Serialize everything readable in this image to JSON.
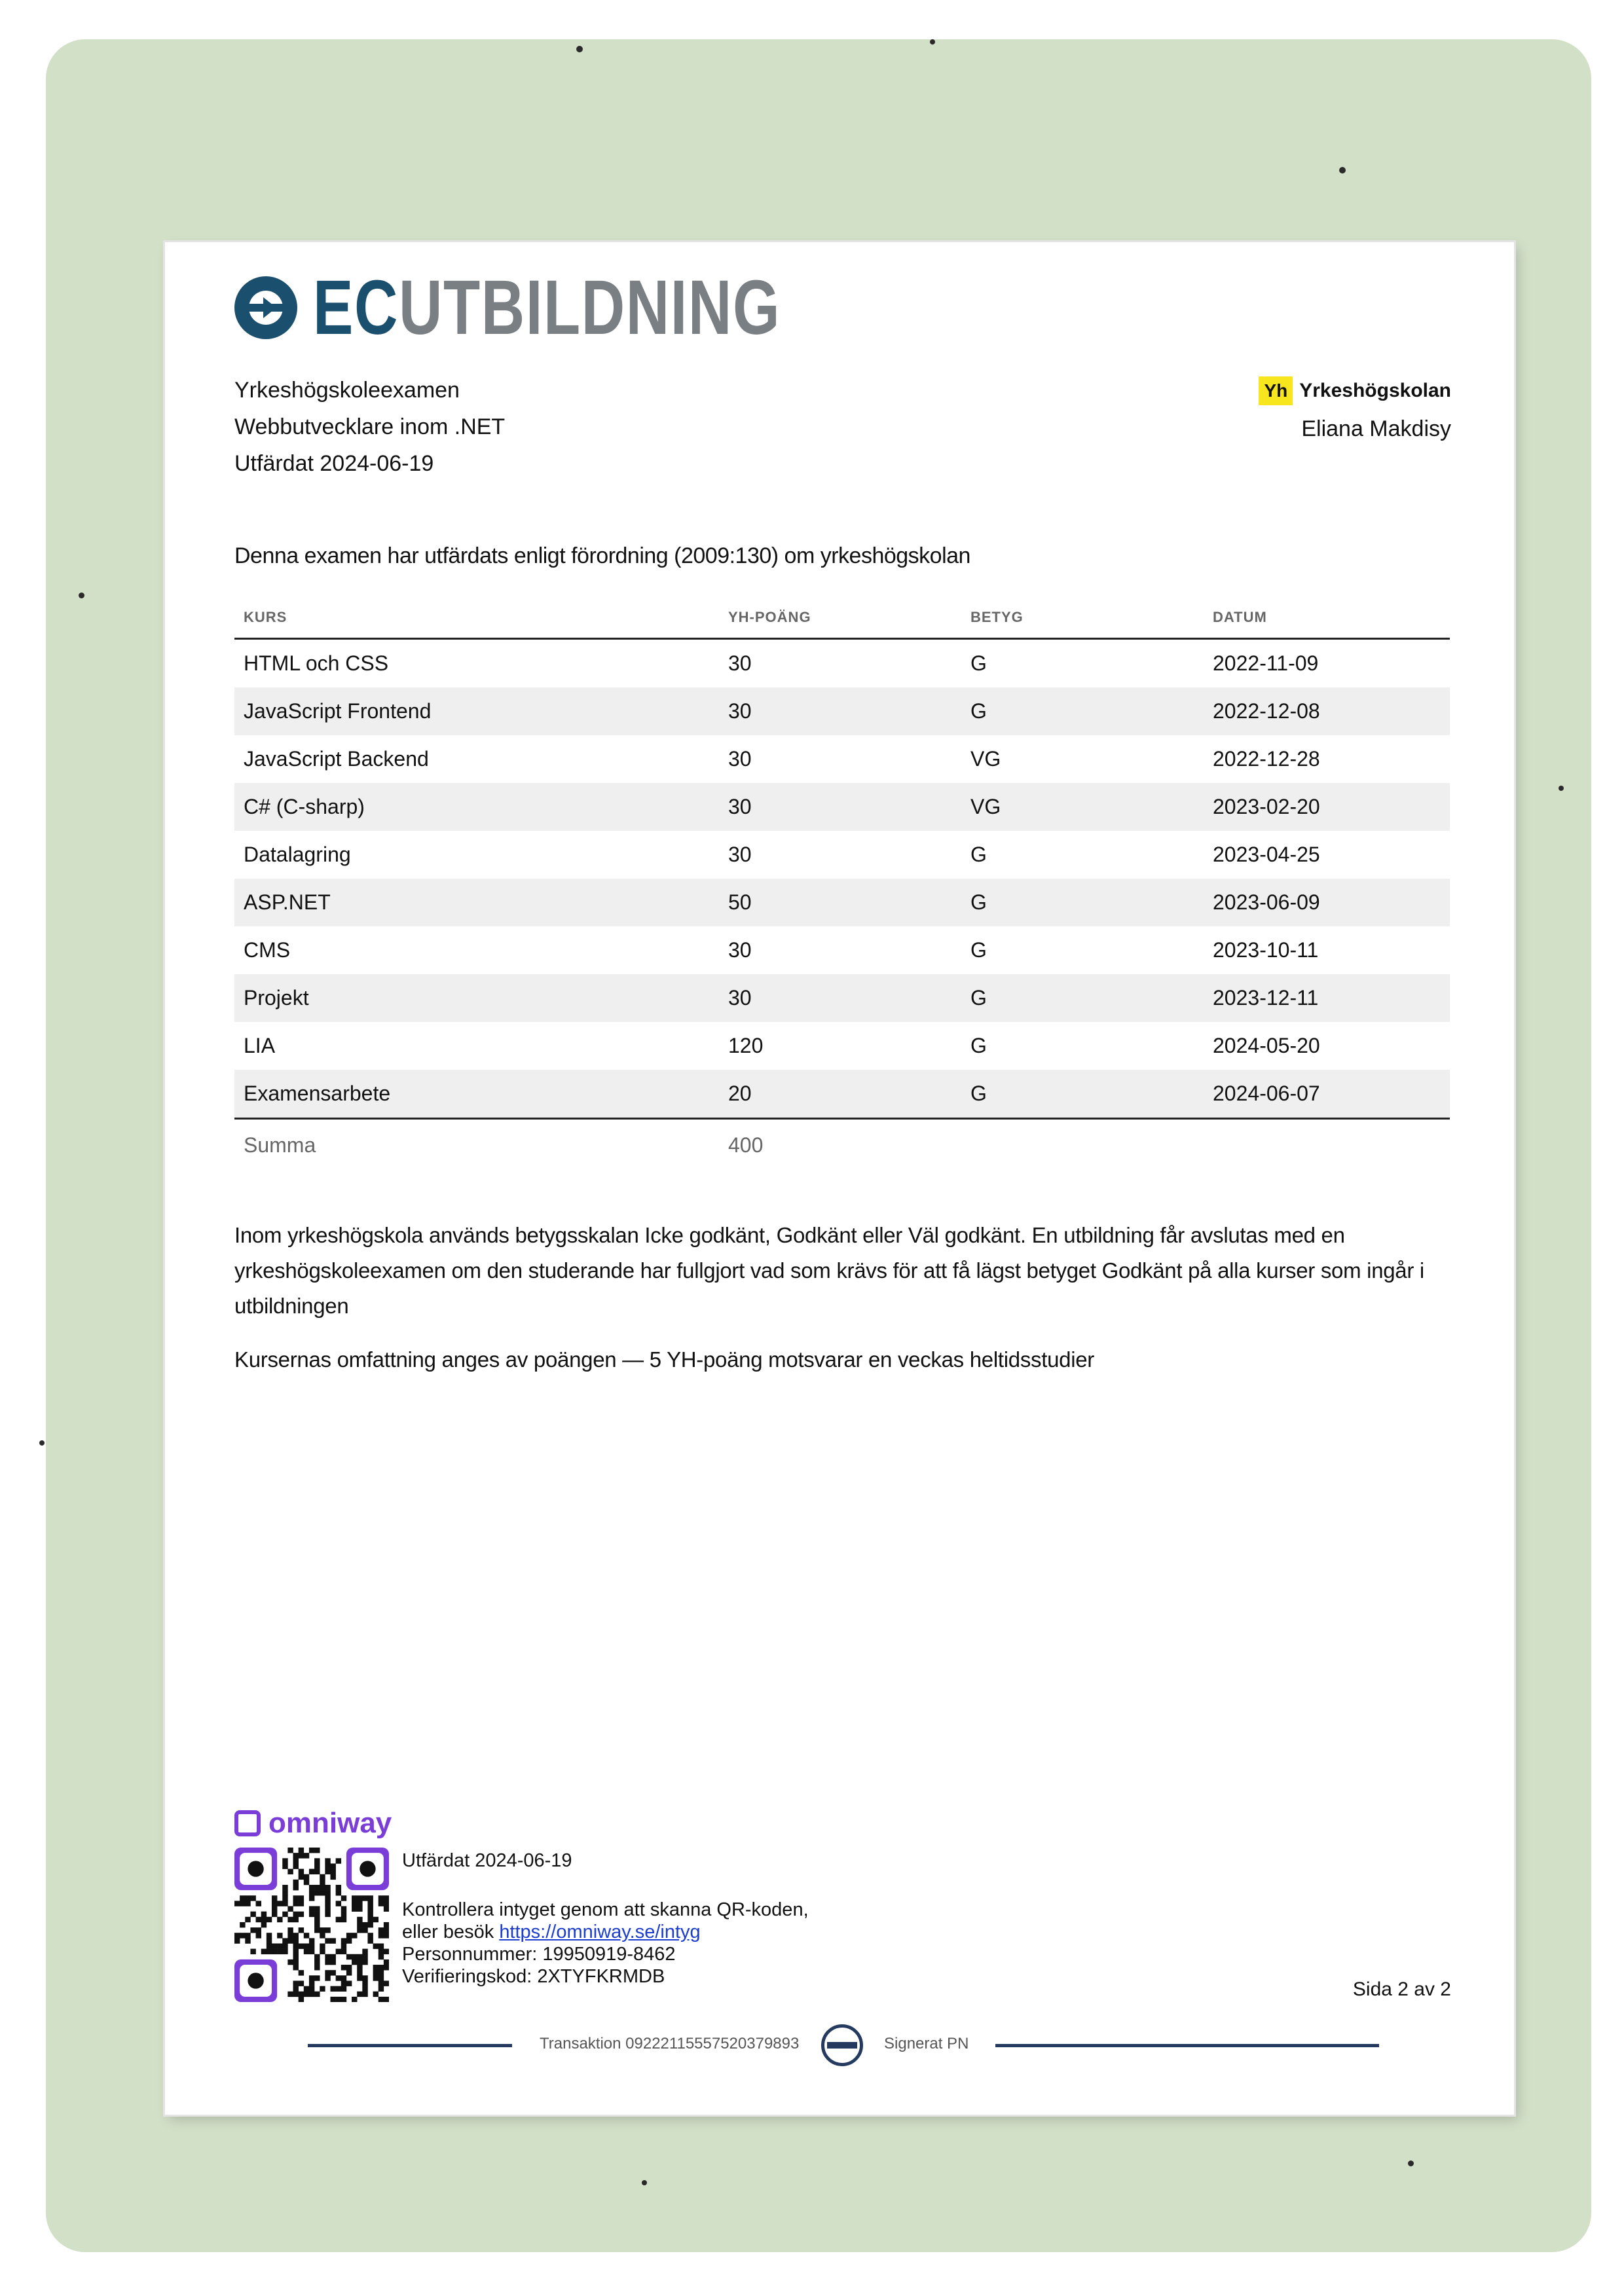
{
  "brand": {
    "prefix": "EC",
    "rest": "UTBILDNING"
  },
  "header": {
    "lines": [
      "Yrkeshögskoleexamen",
      "Webbutvecklare inom .NET",
      "Utfärdat 2024-06-19"
    ],
    "badge": "Yh",
    "school": "Yrkeshögskolan",
    "student": "Eliana Makdisy"
  },
  "intro": "Denna examen har utfärdats enligt förordning (2009:130) om yrkeshögskolan",
  "table": {
    "headers": [
      "KURS",
      "YH-POÄNG",
      "BETYG",
      "DATUM"
    ],
    "rows": [
      [
        "HTML och CSS",
        "30",
        "G",
        "2022-11-09"
      ],
      [
        "JavaScript Frontend",
        "30",
        "G",
        "2022-12-08"
      ],
      [
        "JavaScript Backend",
        "30",
        "VG",
        "2022-12-28"
      ],
      [
        "C# (C-sharp)",
        "30",
        "VG",
        "2023-02-20"
      ],
      [
        "Datalagring",
        "30",
        "G",
        "2023-04-25"
      ],
      [
        "ASP.NET",
        "50",
        "G",
        "2023-06-09"
      ],
      [
        "CMS",
        "30",
        "G",
        "2023-10-11"
      ],
      [
        "Projekt",
        "30",
        "G",
        "2023-12-11"
      ],
      [
        "LIA",
        "120",
        "G",
        "2024-05-20"
      ],
      [
        "Examensarbete",
        "20",
        "G",
        "2024-06-07"
      ]
    ],
    "sum_label": "Summa",
    "sum_value": "400"
  },
  "notes": [
    "Inom yrkeshögskola används betygsskalan Icke godkänt, Godkänt eller Väl godkänt. En utbildning får avslutas med en yrkeshögskoleexamen om den studerande har fullgjort vad som krävs för att få lägst betyget Godkänt på alla kurser som ingår i utbildningen",
    "Kursernas omfattning anges av poängen — 5 YH-poäng motsvarar en veckas heltidsstudier"
  ],
  "footer": {
    "brand": "omniway",
    "issued": "Utfärdat 2024-06-19",
    "check_line": "Kontrollera intyget genom att skanna QR-koden,",
    "visit_prefix": "eller besök ",
    "link": "https://omniway.se/intyg",
    "personnummer": "Personnummer: 19950919-8462",
    "code": "Verifieringskod: 2XTYFKRMDB",
    "page": "Sida 2 av 2",
    "transaction": "Transaktion 09222115557520379893",
    "signed": "Signerat PN"
  },
  "colors": {
    "background": "#d3e0c8",
    "brand_blue": "#1a4f6e",
    "omniway_purple": "#7a3dd8",
    "badge_yellow": "#f7e51e"
  },
  "icons": {
    "logo": "ec-logo-icon",
    "seal": "seal-icon",
    "qr": "qr-code"
  }
}
